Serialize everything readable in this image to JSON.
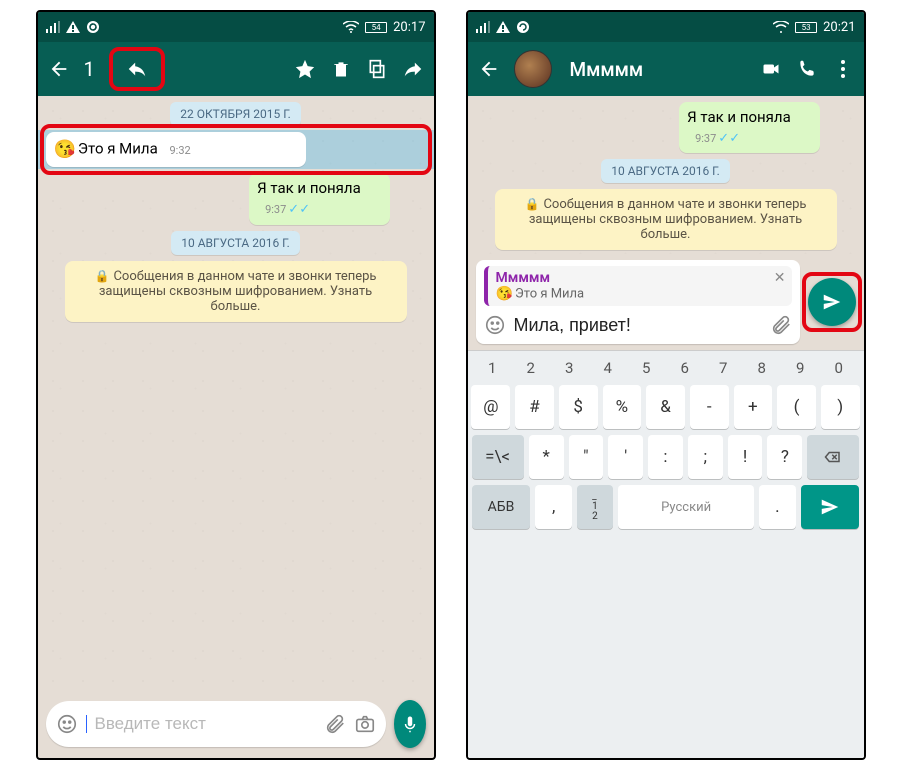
{
  "phone1": {
    "status": {
      "battery": "54",
      "time": "20:17"
    },
    "header": {
      "selected_count": "1"
    },
    "chat": {
      "date1": "22 ОКТЯБРЯ 2015 Г.",
      "msg_in": {
        "text": "Это я Мила",
        "time": "9:32"
      },
      "msg_out": {
        "text": "Я так и поняла",
        "time": "9:37"
      },
      "date2": "10 АВГУСТА 2016 Г.",
      "encryption": "Сообщения в данном чате и звонки теперь защищены сквозным шифрованием. Узнать больше."
    },
    "input": {
      "placeholder": "Введите текст"
    }
  },
  "phone2": {
    "status": {
      "battery": "53",
      "time": "20:21"
    },
    "header": {
      "title": "Ммммм"
    },
    "chat": {
      "msg_out": {
        "text": "Я так и поняла",
        "time": "9:37"
      },
      "date2": "10 АВГУСТА 2016 Г.",
      "encryption": "Сообщения в данном чате и звонки теперь защищены сквозным шифрованием. Узнать больше."
    },
    "reply": {
      "from": "Ммммм",
      "snippet": "Это я Мила"
    },
    "input": {
      "value": "Мила, привет!"
    },
    "keyboard": {
      "row_top": [
        "1",
        "2",
        "3",
        "4",
        "5",
        "6",
        "7",
        "8",
        "9",
        "0"
      ],
      "row1": [
        "@",
        "#",
        "$",
        "%",
        "&",
        "-",
        "+",
        "(",
        ")"
      ],
      "row2": [
        "*",
        "\"",
        "'",
        ":",
        ";",
        "!",
        "?"
      ],
      "row2_left": "=\\<",
      "row3_left": "АБВ",
      "row3_center": "Русский",
      "row3_comma": ",",
      "row3_shift_label": "_\n1\n2"
    }
  }
}
